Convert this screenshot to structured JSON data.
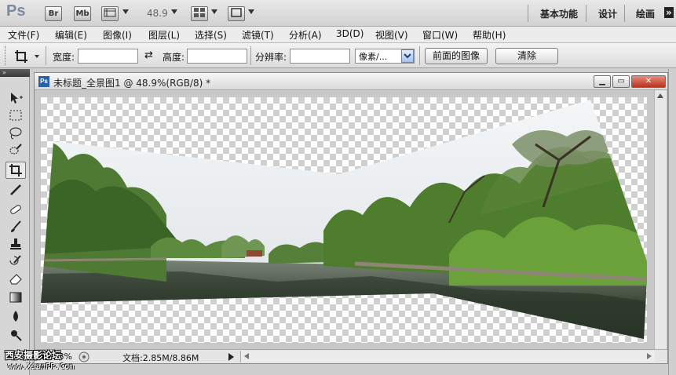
{
  "app": {
    "logo": "Ps",
    "bridge_btn": "Br",
    "minibridge_btn": "Mb",
    "zoom": "48.9",
    "workspaces": [
      "基本功能",
      "设计",
      "绘画"
    ],
    "workspace_more": "»"
  },
  "menu": [
    "文件(F)",
    "编辑(E)",
    "图像(I)",
    "图层(L)",
    "选择(S)",
    "滤镜(T)",
    "分析(A)",
    "3D(D)",
    "视图(V)",
    "窗口(W)",
    "帮助(H)"
  ],
  "options": {
    "width_label": "宽度:",
    "width_value": "",
    "height_label": "高度:",
    "height_value": "",
    "resolution_label": "分辨率:",
    "resolution_value": "",
    "unit_selected": "像素/...",
    "front_image_button": "前面的图像",
    "clear_button": "清除"
  },
  "document": {
    "title": "未标题_全景图1 @ 48.9%(RGB/8) *",
    "ps_badge": "Ps",
    "status_info": "文档:2.85M/8.86M",
    "status_zoom": "48.88%"
  },
  "window_controls": {
    "minimize": "▁",
    "restore": "▭",
    "close": "✕"
  },
  "watermark": {
    "line1": "西安摄影论坛",
    "line2": "www.XianPP.Com"
  },
  "colors": {
    "ps_blue": "#2b61a8",
    "close_red": "#c8402a",
    "checker": "#cfcfcf"
  }
}
